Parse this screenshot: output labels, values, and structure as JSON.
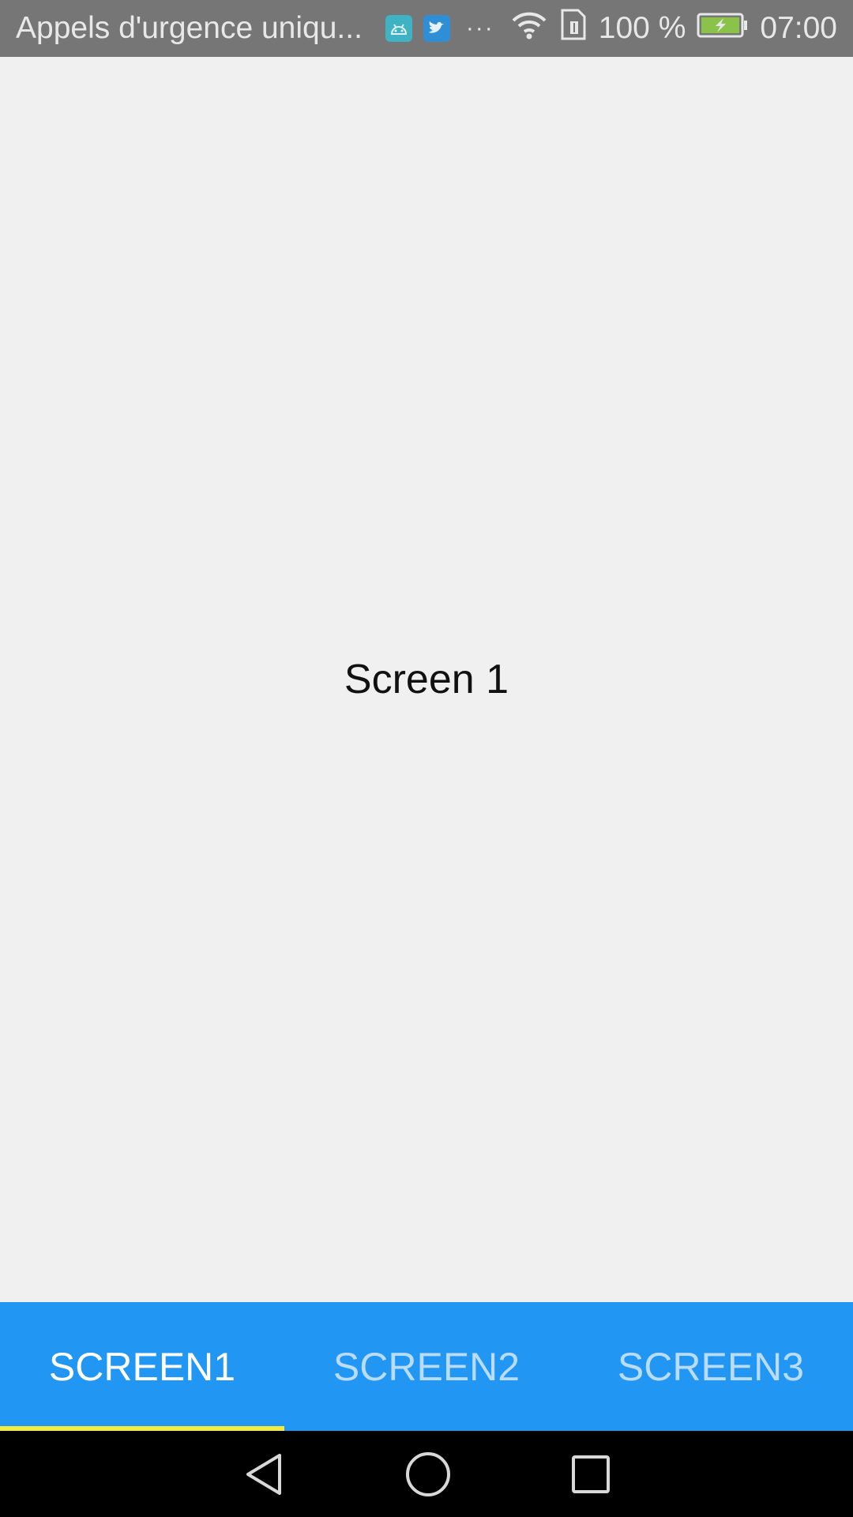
{
  "status_bar": {
    "notification": "Appels d'urgence uniqu...",
    "icons": [
      "android-app-icon",
      "twitter-icon",
      "more-dots-icon",
      "wifi-icon",
      "sim-icon",
      "battery-charging-icon"
    ],
    "battery": "100 %",
    "time": "07:00"
  },
  "main": {
    "label": "Screen 1"
  },
  "tabs": [
    {
      "label": "SCREEN1",
      "active": true
    },
    {
      "label": "SCREEN2",
      "active": false
    },
    {
      "label": "SCREEN3",
      "active": false
    }
  ],
  "colors": {
    "status_bar": "#767676",
    "tab_bar": "#2196f3",
    "tab_indicator": "#f5eb3b",
    "background": "#f0f0f0",
    "nav_bar": "#000000"
  },
  "nav_bar": {
    "icons": [
      "back-icon",
      "home-icon",
      "recents-icon"
    ]
  }
}
